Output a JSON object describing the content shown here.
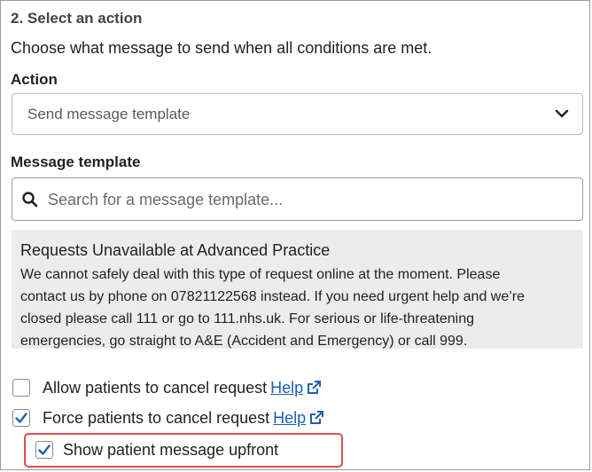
{
  "section": {
    "title": "2. Select an action",
    "description": "Choose what message to send when all conditions are met."
  },
  "action": {
    "label": "Action",
    "selected": "Send message template",
    "icon": "chevron-down-icon"
  },
  "template": {
    "label": "Message template",
    "placeholder": "Search for a message template...",
    "icon": "search-icon"
  },
  "preview": {
    "title": "Requests Unavailable at Advanced Practice",
    "body_lines": [
      "We cannot safely deal with this type of request online at the moment. Please",
      "contact us by phone on 07821122568 instead. If you need urgent help and we’re",
      "closed please call 111 or go to 111.nhs.uk. For serious or life-threatening",
      "emergencies, go straight to A&E (Accident and Emergency) or call 999."
    ]
  },
  "options": [
    {
      "label": "Allow patients to cancel request",
      "checked": false,
      "help": "Help"
    },
    {
      "label": "Force patients to cancel request",
      "checked": true,
      "help": "Help"
    },
    {
      "label": "Show patient message upfront",
      "checked": true
    }
  ],
  "colors": {
    "accent": "#1a5fb4",
    "highlight": "#d9534f",
    "preview_bg": "#ececec"
  }
}
